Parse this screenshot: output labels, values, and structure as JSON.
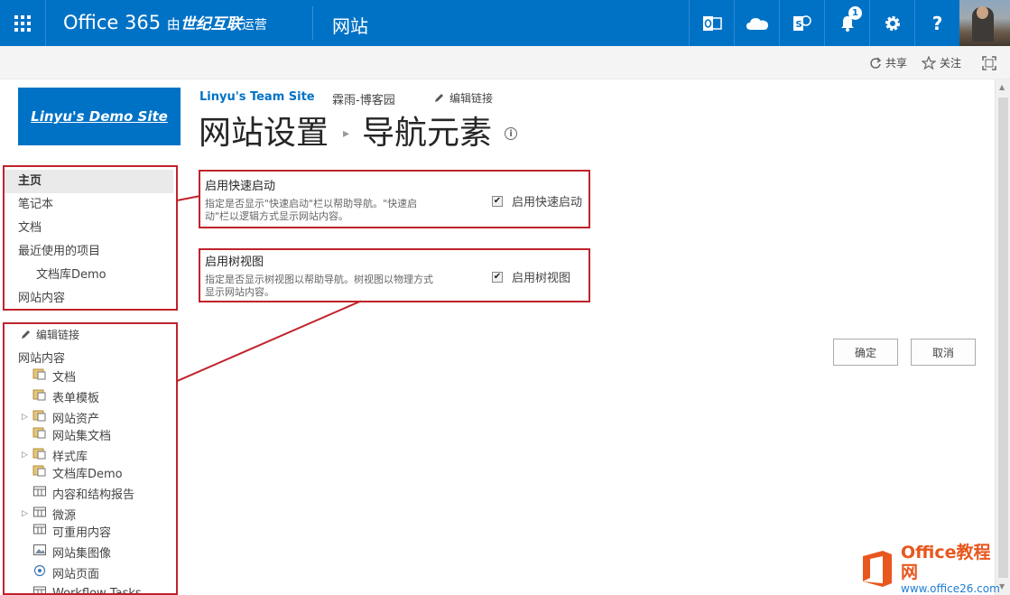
{
  "suite": {
    "brand_main": "Office 365",
    "brand_by": "由",
    "brand_operator": "世纪互联",
    "brand_suffix": "运营",
    "title": "网站",
    "notification_count": "1",
    "accent": "#0072c6"
  },
  "ribbon": {
    "share_label": "共享",
    "follow_label": "关注"
  },
  "site": {
    "logo_text": "Linyu's Demo Site",
    "topnav": [
      "Linyu's Team Site",
      "霖雨-博客园"
    ],
    "edit_links": "编辑链接"
  },
  "page": {
    "breadcrumb_parent": "网站设置",
    "breadcrumb_current": "导航元素",
    "info_glyph": "i"
  },
  "quick_launch": {
    "items": [
      {
        "label": "主页"
      },
      {
        "label": "笔记本"
      },
      {
        "label": "文档"
      },
      {
        "label": "最近使用的项目"
      },
      {
        "label": "文档库Demo"
      },
      {
        "label": "网站内容"
      }
    ]
  },
  "tree": {
    "edit_links": "编辑链接",
    "root": "网站内容",
    "items": [
      {
        "label": "文档",
        "icon": "library-icon",
        "expandable": false
      },
      {
        "label": "表单模板",
        "icon": "library-icon",
        "expandable": false
      },
      {
        "label": "网站资产",
        "icon": "library-icon",
        "expandable": true
      },
      {
        "label": "网站集文档",
        "icon": "library-icon",
        "expandable": false
      },
      {
        "label": "样式库",
        "icon": "library-icon",
        "expandable": true
      },
      {
        "label": "文档库Demo",
        "icon": "library-icon",
        "expandable": false
      },
      {
        "label": "内容和结构报告",
        "icon": "list-icon",
        "expandable": false
      },
      {
        "label": "微源",
        "icon": "list-icon",
        "expandable": true
      },
      {
        "label": "可重用内容",
        "icon": "list-icon",
        "expandable": false
      },
      {
        "label": "网站集图像",
        "icon": "picture-library-icon",
        "expandable": false
      },
      {
        "label": "网站页面",
        "icon": "site-pages-icon",
        "expandable": false
      },
      {
        "label": "Workflow Tasks",
        "icon": "list-icon",
        "expandable": false
      }
    ]
  },
  "settings": {
    "quick_launch": {
      "title": "启用快速启动",
      "description": "指定是否显示\"快速启动\"栏以帮助导航。\"快速启动\"栏以逻辑方式显示网站内容。",
      "checkbox_label": "启用快速启动",
      "checked": true
    },
    "tree_view": {
      "title": "启用树视图",
      "description": "指定是否显示树视图以帮助导航。树视图以物理方式显示网站内容。",
      "checkbox_label": "启用树视图",
      "checked": true
    }
  },
  "actions": {
    "ok_label": "确定",
    "cancel_label": "取消"
  },
  "watermark": {
    "title": "Office教程网",
    "url": "www.office26.com"
  },
  "colors": {
    "annotation_red": "#c0232c",
    "watermark_orange": "#e8571e"
  }
}
